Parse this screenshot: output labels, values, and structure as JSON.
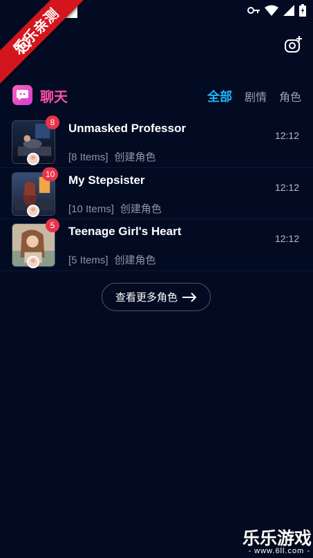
{
  "watermark_ribbon": "乐乐亲测",
  "header": {
    "title": "聊天",
    "tabs": [
      {
        "label": "全部",
        "active": true
      },
      {
        "label": "剧情",
        "active": false
      },
      {
        "label": "角色",
        "active": false
      }
    ]
  },
  "chats": [
    {
      "name": "Unmasked Professor",
      "time": "12:12",
      "items": "[8 Items]",
      "role": "创建角色",
      "unread": "8"
    },
    {
      "name": "My Stepsister",
      "time": "12:12",
      "items": "[10 Items]",
      "role": "创建角色",
      "unread": "10"
    },
    {
      "name": "Teenage Girl's Heart",
      "time": "12:12",
      "items": "[5 Items]",
      "role": "创建角色",
      "unread": "5"
    }
  ],
  "more_button": {
    "label": "查看更多角色"
  },
  "watermark": {
    "title": "乐乐游戏",
    "url": "- www.6ll.com -"
  },
  "icons": {
    "settings": "gear-icon",
    "camera": "camera-add-icon",
    "logo": "chat-bubble-icon",
    "arrow": "arrow-right-icon"
  },
  "colors": {
    "background": "#020b22",
    "accent_tab": "#1fb5ff",
    "title_pink": "#ff4fab",
    "badge_red": "#e9334a"
  }
}
